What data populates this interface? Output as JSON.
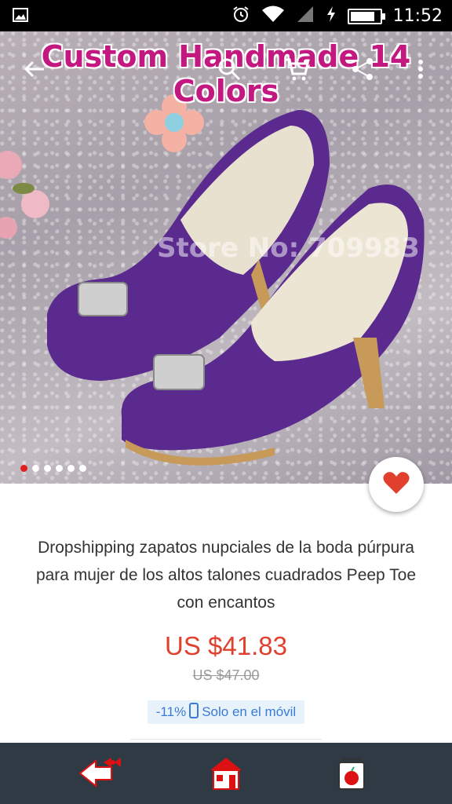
{
  "status_bar": {
    "time": "11:52",
    "icons": [
      "image-icon",
      "alarm-icon",
      "wifi-icon",
      "signal-icon",
      "charging-icon",
      "battery-icon"
    ],
    "battery_level": 0.85
  },
  "hero": {
    "overlay_title": "Custom Handmade 14 Colors",
    "watermark": "Store No: 709983",
    "toolbar_icons": [
      "back-arrow-icon",
      "search-icon",
      "cart-icon",
      "share-icon",
      "more-icon"
    ],
    "carousel": {
      "count": 6,
      "active_index": 0
    }
  },
  "product": {
    "title": "Dropshipping zapatos nupciales de la boda púrpura para mujer de los altos talones cuadrados Peep Toe con encantos",
    "price": "US $41.83",
    "original_price": "US $47.00",
    "discount": "-11%",
    "mobile_only": "Solo en el móvil"
  },
  "bottom_nav": {
    "items": [
      "back-bow-icon",
      "store-icon",
      "apple-bag-icon"
    ]
  },
  "colors": {
    "accent_red": "#e0402d",
    "title_magenta": "#c2187f",
    "badge_blue": "#3a7bd5",
    "nav_bg": "#2f3a44",
    "shoe_purple": "#5b2a8e"
  }
}
